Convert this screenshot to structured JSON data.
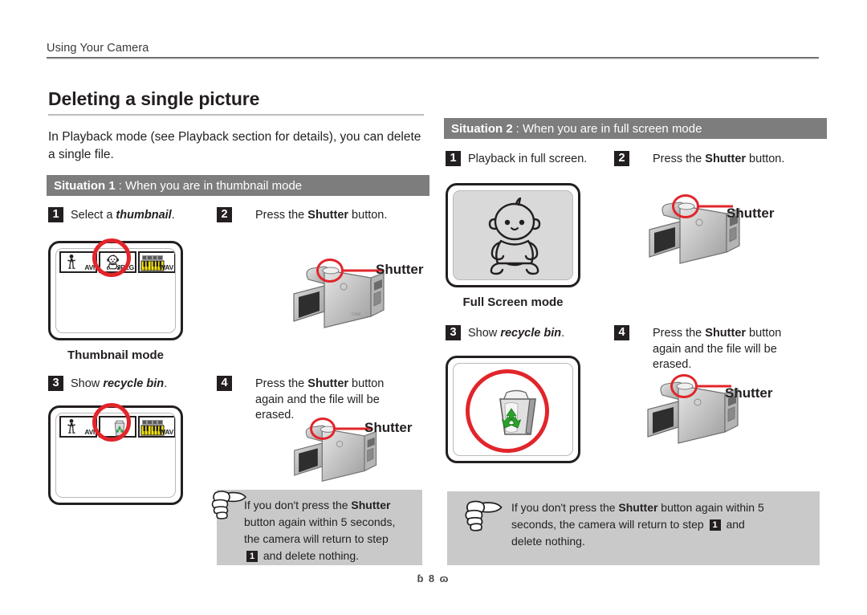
{
  "header": {
    "running_head": "Using Your Camera"
  },
  "title": "Deleting a single picture",
  "intro": "In Playback mode (see Playback section for details), you can delete a single file.",
  "situations": [
    {
      "label": "Situation 1",
      "separator": " : ",
      "description": "When you are in thumbnail mode",
      "steps": [
        {
          "num": "1",
          "text_before": "Select a ",
          "emphasis": "thumbnail",
          "text_after": "."
        },
        {
          "num": "2",
          "text_before": "Press the ",
          "emphasis": "Shutter",
          "text_after": " button."
        },
        {
          "num": "3",
          "text_before": "Show ",
          "emphasis": "recycle bin",
          "text_after": "."
        },
        {
          "num": "4",
          "text_before": "Press the ",
          "emphasis": "Shutter",
          "text_after": " button again and the file will be erased."
        }
      ],
      "screen_caption": "Thumbnail mode",
      "thumbnails_initial": [
        {
          "label": "AVI",
          "glyph": "person-figure-icon",
          "highlighted": false
        },
        {
          "label": "JPEG",
          "glyph": "baby-face-icon",
          "highlighted": true
        },
        {
          "label": "WAV",
          "glyph": "piano-keyboard-icon",
          "highlighted": false
        }
      ],
      "thumbnails_after": [
        {
          "label": "AVI",
          "glyph": "person-figure-icon",
          "highlighted": false
        },
        {
          "label": "",
          "glyph": "recycle-bin-icon",
          "highlighted": true
        },
        {
          "label": "WAV",
          "glyph": "piano-keyboard-icon",
          "highlighted": false
        }
      ],
      "shutter_callout": "Shutter",
      "note": {
        "line1_before": "If you don't press the ",
        "line1_bold": "Shutter",
        "line2": "button again within 5 seconds,",
        "line3": "the camera will return to step",
        "step_ref": "1",
        "line4": "and delete nothing."
      }
    },
    {
      "label": "Situation 2",
      "separator": " : ",
      "description": "When you are in full screen mode",
      "steps": [
        {
          "num": "1",
          "text_before": "Playback in full screen.",
          "emphasis": "",
          "text_after": ""
        },
        {
          "num": "2",
          "text_before": "Press the ",
          "emphasis": "Shutter",
          "text_after": " button."
        },
        {
          "num": "3",
          "text_before": "Show ",
          "emphasis": "recycle bin",
          "text_after": "."
        },
        {
          "num": "4",
          "text_before": "Press the ",
          "emphasis": "Shutter",
          "text_after": " button again and the file will be erased."
        }
      ],
      "screen_caption": "Full Screen mode",
      "full_screen_glyph": "baby-illustration-icon",
      "recycle_glyph": "recycle-bin-icon",
      "shutter_callout": "Shutter",
      "note": {
        "line1_before": "If you don't press the ",
        "line1_bold": "Shutter",
        "line1_after": " button again within 5",
        "line2": "seconds, the camera will return to step",
        "step_ref": "1",
        "line2_after": "and",
        "line3": "delete nothing."
      }
    }
  ],
  "footer": {
    "page_number": "8",
    "ornament_left": "ɓ",
    "ornament_right": "ɷ"
  },
  "colors": {
    "ink": "#231f20",
    "situation_bar": "#7d7d7d",
    "note_bg": "#c9c9c9",
    "highlight_red": "#e1252b",
    "screen_gray": "#d9d9d9",
    "recycle_green": "#2f9e44"
  }
}
